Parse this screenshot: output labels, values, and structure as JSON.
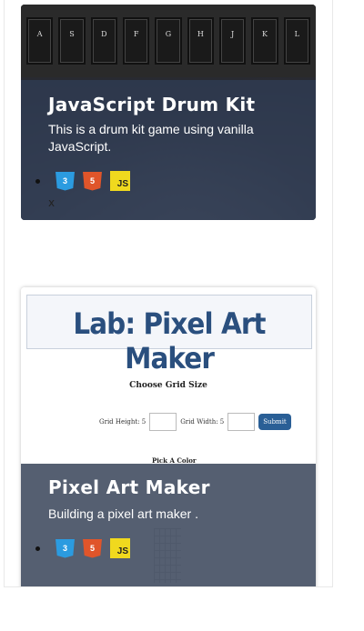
{
  "projects": [
    {
      "title": "JavaScript Drum Kit",
      "description": "This is a drum kit game using vanilla JavaScript.",
      "preview_keys": [
        "A",
        "S",
        "D",
        "F",
        "G",
        "H",
        "J",
        "K",
        "L"
      ],
      "tech_icons": [
        "css3-icon",
        "html5-icon",
        "js-icon"
      ],
      "badges": {
        "css": "3",
        "html": "5",
        "js": "JS"
      },
      "extra_text": "x"
    },
    {
      "title": "Pixel Art Maker",
      "description": "Building a pixel art maker .",
      "preview": {
        "banner": "Lab: Pixel Art Maker",
        "choose_grid": "Choose Grid Size",
        "grid_height_label": "Grid Height: 5",
        "grid_width_label": "Grid Width: 5",
        "submit": "Submit",
        "pick_color": "Pick A Color"
      },
      "tech_icons": [
        "css3-icon",
        "html5-icon",
        "js-icon"
      ],
      "badges": {
        "css": "3",
        "html": "5",
        "js": "JS"
      }
    }
  ]
}
